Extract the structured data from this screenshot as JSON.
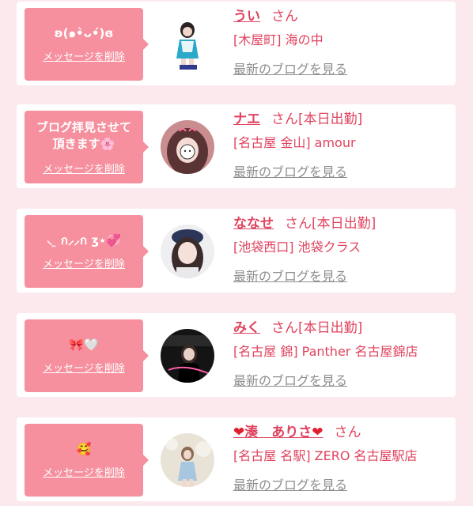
{
  "cards": [
    {
      "message": "ʚ(๑•̀ᴗ•́)ɞ",
      "delete_label": "メッセージを削除",
      "name": "うい",
      "honorific": "さん",
      "status": "",
      "shop": "[木屋町] 海の中",
      "blog_link": "最新のブログを見る"
    },
    {
      "message_line1": "ブログ拝見させて",
      "message_line2": "頂きます🌸",
      "delete_label": "メッセージを削除",
      "name": "ナエ",
      "honorific": "さん",
      "status": "[本日出勤]",
      "shop": "[名古屋 金山] amour",
      "blog_link": "最新のブログを見る"
    },
    {
      "message": "⸜ ̯ ก⸝⸝ก ʒ⋆💞",
      "delete_label": "メッセージを削除",
      "name": "ななせ",
      "honorific": "さん",
      "status": "[本日出勤]",
      "shop": "[池袋西口] 池袋クラス",
      "blog_link": "最新のブログを見る"
    },
    {
      "message": "🎀🤍",
      "delete_label": "メッセージを削除",
      "name": "みく",
      "honorific": "さん",
      "status": "[本日出勤]",
      "shop": "[名古屋 錦] Panther 名古屋錦店",
      "blog_link": "最新のブログを見る"
    },
    {
      "message": "🥰",
      "delete_label": "メッセージを削除",
      "name": "湊　ありさ",
      "name_prefix": "❤",
      "name_suffix": "❤",
      "honorific": "さん",
      "status": "",
      "shop": "[名古屋 名駅] ZERO 名古屋駅店",
      "blog_link": "最新のブログを見る"
    }
  ]
}
